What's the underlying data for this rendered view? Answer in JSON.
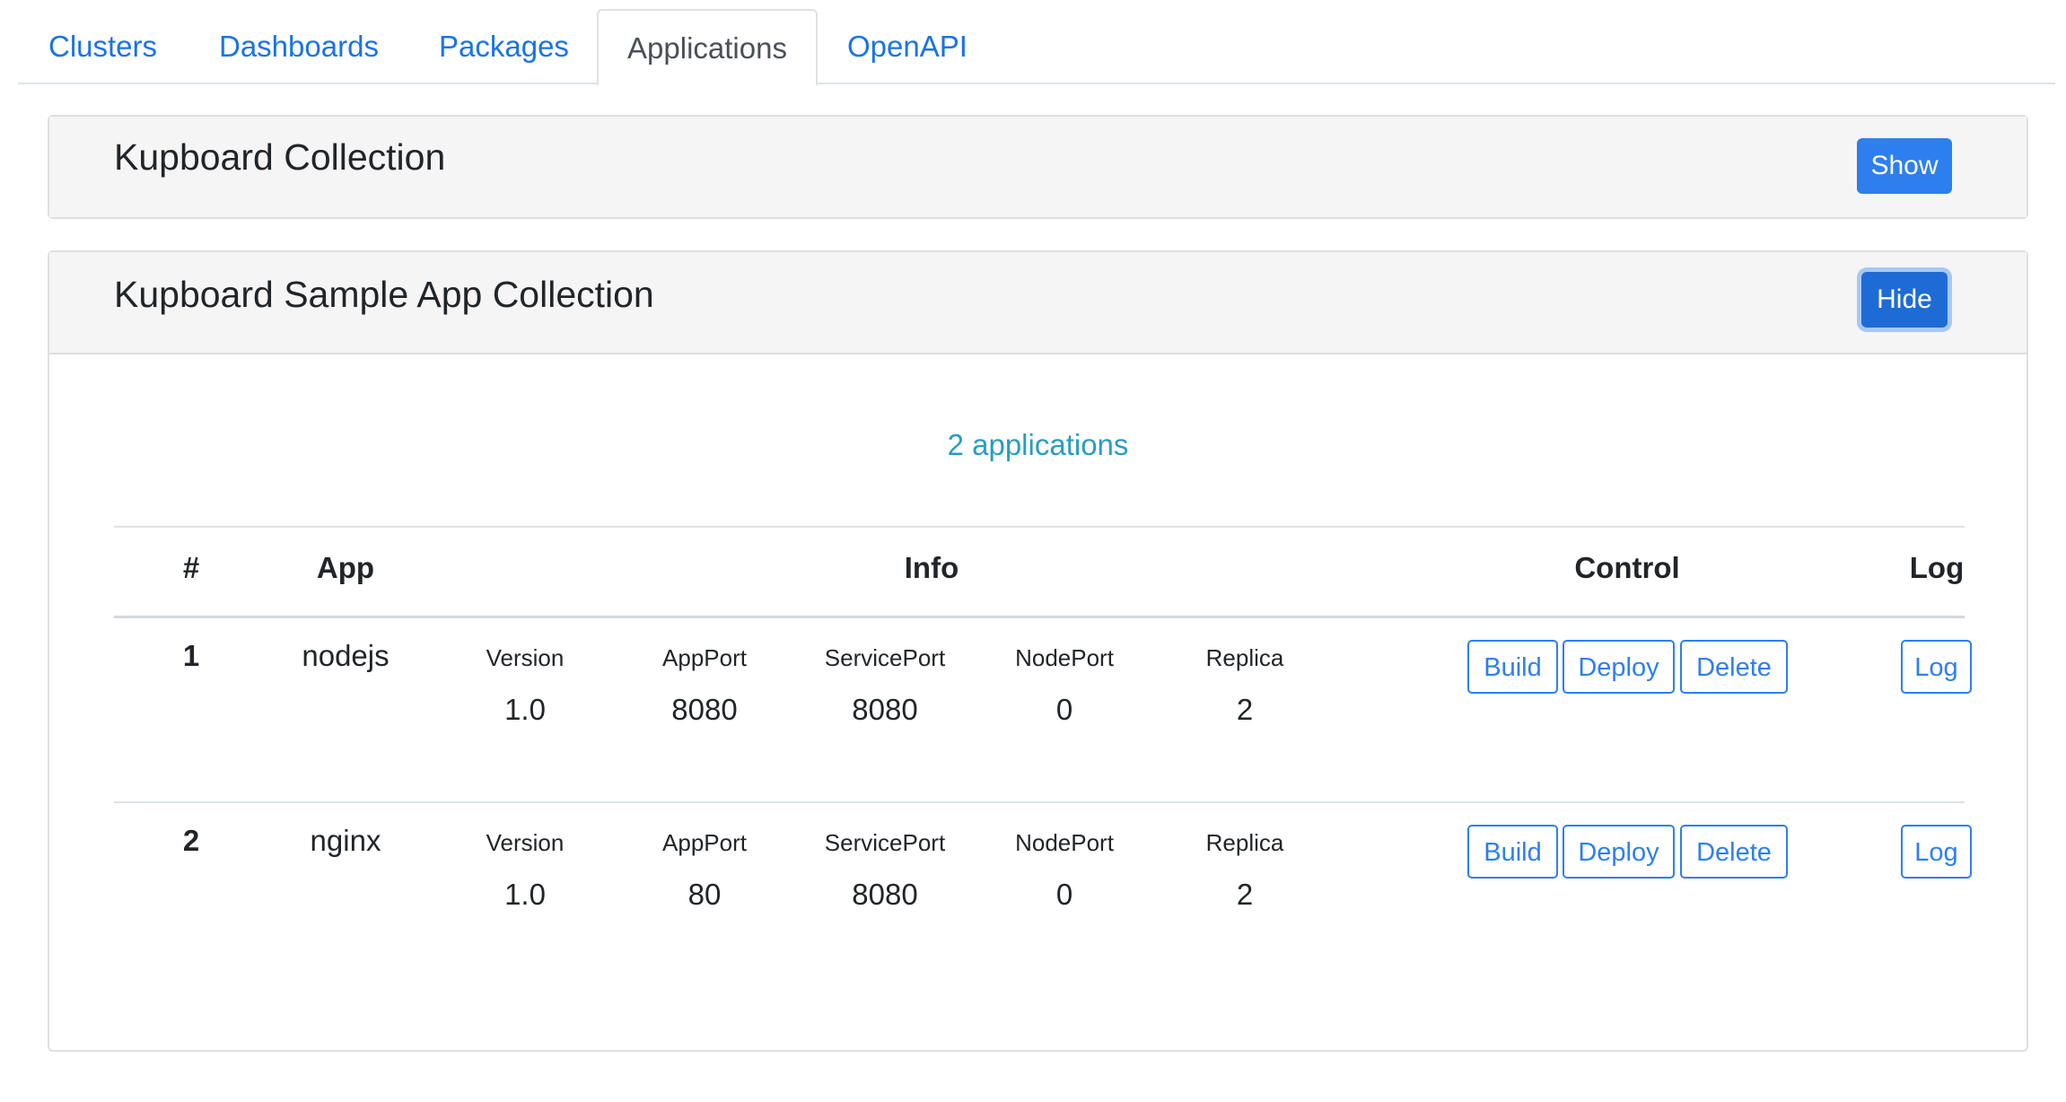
{
  "tabs": [
    {
      "label": "Clusters",
      "active": false
    },
    {
      "label": "Dashboards",
      "active": false
    },
    {
      "label": "Packages",
      "active": false
    },
    {
      "label": "Applications",
      "active": true
    },
    {
      "label": "OpenAPI",
      "active": false
    }
  ],
  "collections": [
    {
      "title": "Kupboard Collection",
      "toggle_label": "Show",
      "expanded": false
    },
    {
      "title": "Kupboard Sample App Collection",
      "toggle_label": "Hide",
      "expanded": true
    }
  ],
  "apps_summary": "2 applications",
  "table": {
    "headers": {
      "index": "#",
      "app": "App",
      "info": "Info",
      "control": "Control",
      "log": "Log"
    },
    "info_labels": [
      "Version",
      "AppPort",
      "ServicePort",
      "NodePort",
      "Replica"
    ],
    "rows": [
      {
        "index": "1",
        "app": "nodejs",
        "version": "1.0",
        "app_port": "8080",
        "service_port": "8080",
        "node_port": "0",
        "replica": "2"
      },
      {
        "index": "2",
        "app": "nginx",
        "version": "1.0",
        "app_port": "80",
        "service_port": "8080",
        "node_port": "0",
        "replica": "2"
      }
    ],
    "buttons": {
      "build": "Build",
      "deploy": "Deploy",
      "delete": "Delete",
      "log": "Log"
    }
  },
  "colors": {
    "primary": "#2d7ff0",
    "link": "#1a73e8",
    "count_text": "#2a9cc0"
  }
}
